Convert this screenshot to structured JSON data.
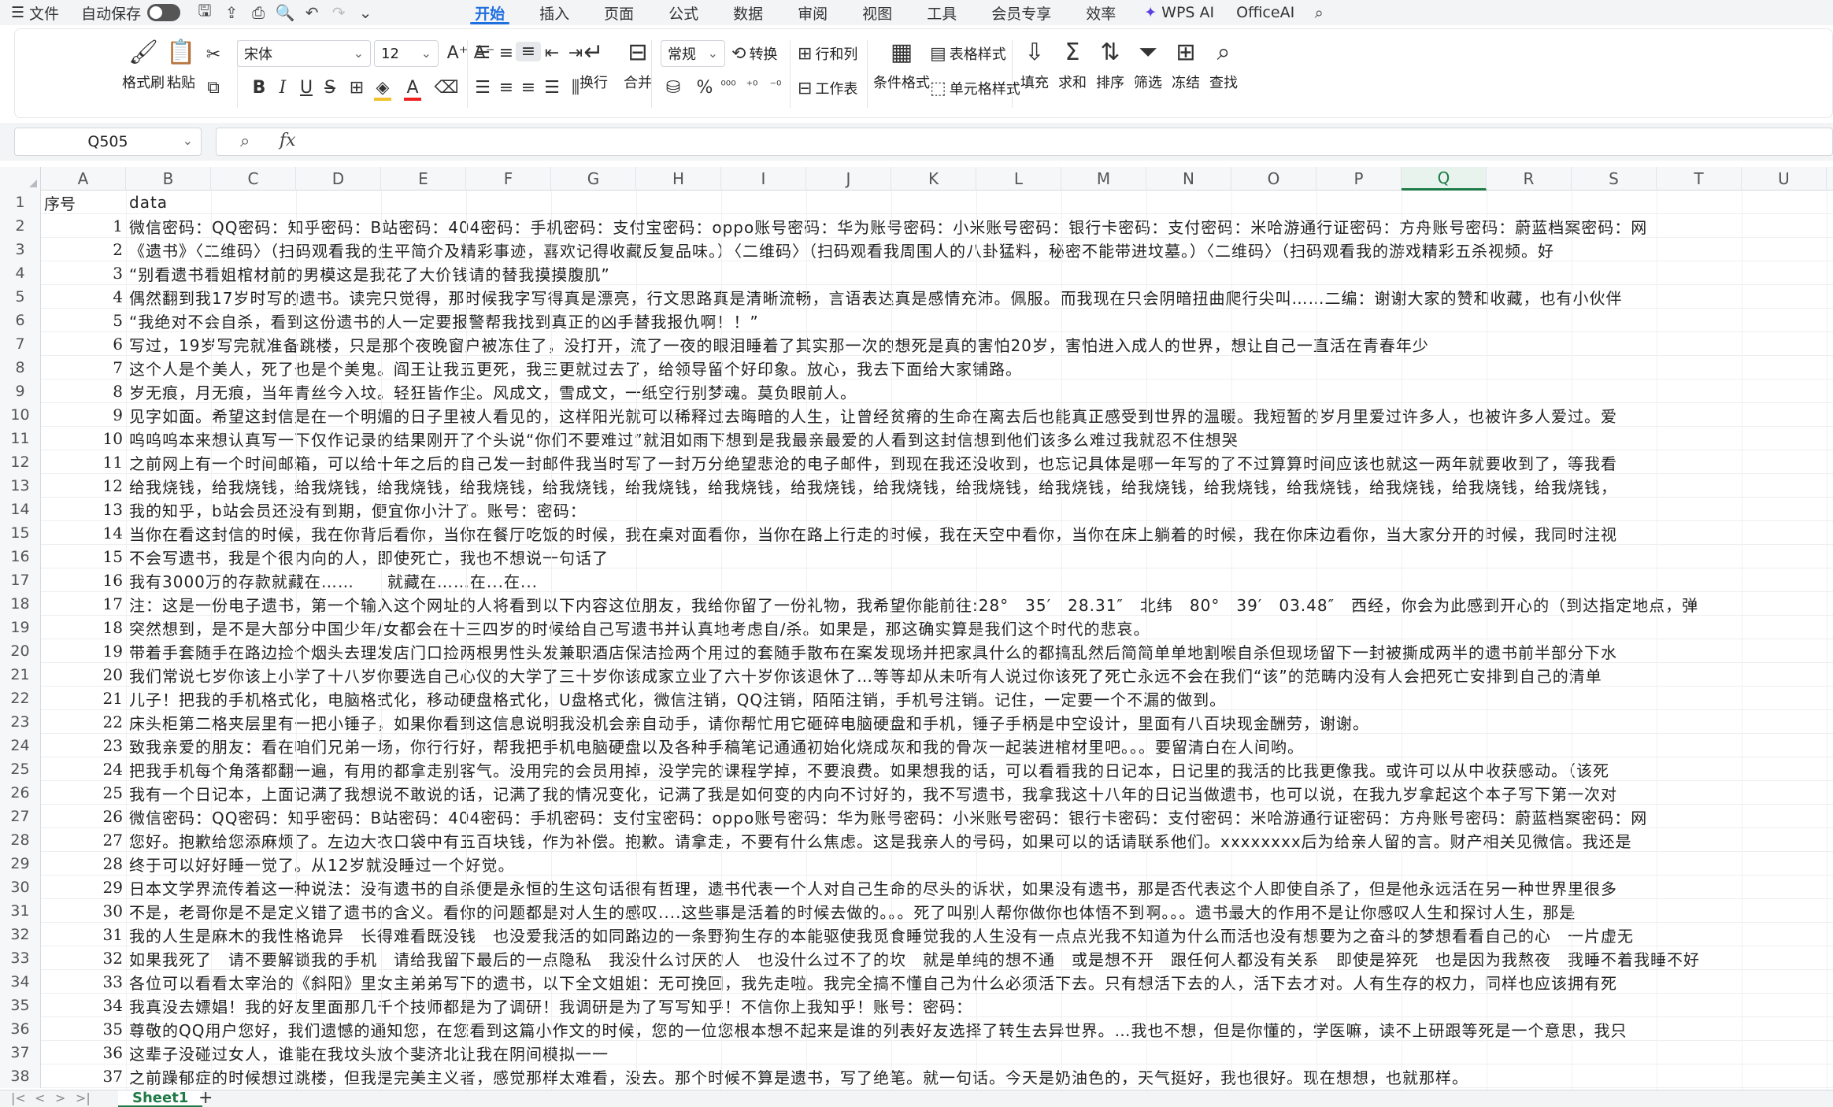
{
  "menu": {
    "file": "文件",
    "autosave": "自动保存",
    "tabs": [
      "开始",
      "插入",
      "页面",
      "公式",
      "数据",
      "审阅",
      "视图",
      "工具",
      "会员专享",
      "效率"
    ],
    "active_tab": "开始",
    "wps_ai": "WPS AI",
    "office_ai": "OfficeAI"
  },
  "ribbon": {
    "format_painter": "格式刷",
    "paste": "粘贴",
    "font_name": "宋体",
    "font_size": "12",
    "bold": "B",
    "italic": "I",
    "underline": "U",
    "strike": "S",
    "font_color_letter": "A",
    "wrap": "换行",
    "merge": "合并",
    "number_format": "常规",
    "convert": "转换",
    "percent": "%",
    "rows_cols": "行和列",
    "worksheet": "工作表",
    "cond_format": "条件格式",
    "table_style": "表格样式",
    "cell_style": "单元格样式",
    "fill": "填充",
    "sum": "求和",
    "sort": "排序",
    "filter": "筛选",
    "freeze": "冻结",
    "find": "查找"
  },
  "formula_bar": {
    "name_box": "Q505",
    "fx": "fx",
    "content": ""
  },
  "columns": [
    "A",
    "B",
    "C",
    "D",
    "E",
    "F",
    "G",
    "H",
    "I",
    "J",
    "K",
    "L",
    "M",
    "N",
    "O",
    "P",
    "Q",
    "R",
    "S",
    "T",
    "U"
  ],
  "selected_column": "Q",
  "header_row": {
    "a": "序号",
    "b": "data"
  },
  "rows": [
    {
      "n": "1",
      "a": "",
      "b": ""
    },
    {
      "n": "2",
      "a": "1",
      "b": "微信密码：QQ密码：知乎密码：B站密码：404密码：手机密码：支付宝密码：oppo账号密码：华为账号密码：小米账号密码：银行卡密码：支付密码：米哈游通行证密码：方舟账号密码：蔚蓝档案密码：网"
    },
    {
      "n": "3",
      "a": "2",
      "b": "《遗书》〈二维码〉（扫码观看我的生平简介及精彩事迹，喜欢记得收藏反复品味。）〈二维码〉（扫码观看我周围人的八卦猛料，秘密不能带进坟墓。）〈二维码〉（扫码观看我的游戏精彩五杀视频。好"
    },
    {
      "n": "4",
      "a": "3",
      "b": "“别看遗书看姐棺材前的男模这是我花了大价钱请的替我摸摸腹肌”"
    },
    {
      "n": "5",
      "a": "4",
      "b": "偶然翻到我17岁时写的遗书。读完只觉得，那时候我字写得真是漂亮，行文思路真是清晰流畅，言语表达真是感情充沛。佩服。而我现在只会阴暗扭曲爬行尖叫……二编：谢谢大家的赞和收藏，也有小伙伴"
    },
    {
      "n": "6",
      "a": "5",
      "b": "“我绝对不会自杀，看到这份遗书的人一定要报警帮我找到真正的凶手替我报仇啊！！”"
    },
    {
      "n": "7",
      "a": "6",
      "b": "写过，19岁写完就准备跳楼，只是那个夜晚窗户被冻住了，没打开，流了一夜的眼泪睡着了其实那一次的想死是真的害怕20岁，害怕进入成人的世界，想让自己一直活在青春年少"
    },
    {
      "n": "8",
      "a": "7",
      "b": "这个人是个美人，死了也是个美鬼。阎王让我五更死，我三更就过去了，给领导留个好印象。放心，我去下面给大家铺路。"
    },
    {
      "n": "9",
      "a": "8",
      "b": "岁无痕，月无痕，当年青丝今入坟。轻狂皆作尘。风成文，雪成文，一纸空行别梦魂。莫负眼前人。"
    },
    {
      "n": "10",
      "a": "9",
      "b": "见字如面。希望这封信是在一个明媚的日子里被人看见的，这样阳光就可以稀释过去晦暗的人生，让曾经贫瘠的生命在离去后也能真正感受到世界的温暖。我短暂的岁月里爱过许多人，也被许多人爱过。爱"
    },
    {
      "n": "11",
      "a": "10",
      "b": "呜呜呜本来想认真写一下仅作记录的结果刚开了个头说“你们不要难过”就泪如雨下想到是我最亲最爱的人看到这封信想到他们该多么难过我就忍不住想哭"
    },
    {
      "n": "12",
      "a": "11",
      "b": "之前网上有一个时间邮箱，可以给十年之后的自己发一封邮件我当时写了一封万分绝望悲沧的电子邮件，到现在我还没收到，也忘记具体是哪一年写的了不过算算时间应该也就这一两年就要收到了，等我看"
    },
    {
      "n": "13",
      "a": "12",
      "b": "给我烧钱，给我烧钱，给我烧钱，给我烧钱，给我烧钱，给我烧钱，给我烧钱，给我烧钱，给我烧钱，给我烧钱，给我烧钱，给我烧钱，给我烧钱，给我烧钱，给我烧钱，给我烧钱，给我烧钱，给我烧钱，"
    },
    {
      "n": "14",
      "a": "13",
      "b": "我的知乎，b站会员还没有到期，便宜你小汁了。账号：密码："
    },
    {
      "n": "15",
      "a": "14",
      "b": "当你在看这封信的时候，我在你背后看你，当你在餐厅吃饭的时候，我在桌对面看你，当你在路上行走的时候，我在天空中看你，当你在床上躺着的时候，我在你床边看你，当大家分开的时候，我同时注视"
    },
    {
      "n": "16",
      "a": "15",
      "b": "不会写遗书，我是个很内向的人，即使死亡，我也不想说一句话了"
    },
    {
      "n": "17",
      "a": "16",
      "b": "我有3000万的存款就藏在……　　就藏在……在...在..."
    },
    {
      "n": "18",
      "a": "17",
      "b": "注：这是一份电子遗书，第一个输入这个网址的人将看到以下内容这位朋友，我给你留了一份礼物，我希望你能前往:28°　35′　28.31″　北纬　80°　39′　03.48″　西经，你会为此感到开心的（到达指定地点，弹"
    },
    {
      "n": "19",
      "a": "18",
      "b": "突然想到，是不是大部分中国少年/女都会在十三四岁的时候给自己写遗书并认真地考虑自/杀。如果是，那这确实算是我们这个时代的悲哀。"
    },
    {
      "n": "20",
      "a": "19",
      "b": "带着手套随手在路边捡个烟头去理发店门口捡两根男性头发兼职酒店保洁捡两个用过的套随手散布在案发现场并把家具什么的都搞乱然后简简单单地割喉自杀但现场留下一封被撕成两半的遗书前半部分下水"
    },
    {
      "n": "21",
      "a": "20",
      "b": "我们常说七岁你该上小学了十八岁你要选自己心仪的大学了三十岁你该成家立业了六十岁你该退休了…等等却从未听有人说过你该死了死亡永远不会在我们“该”的范畴内没有人会把死亡安排到自己的清单"
    },
    {
      "n": "22",
      "a": "21",
      "b": "儿子！把我的手机格式化，电脑格式化，移动硬盘格式化，U盘格式化，微信注销，QQ注销，陌陌注销，手机号注销。记住，一定要一个不漏的做到。"
    },
    {
      "n": "23",
      "a": "22",
      "b": "床头柜第二格夹层里有一把小锤子，如果你看到这信息说明我没机会亲自动手，请你帮忙用它砸碎电脑硬盘和手机，锤子手柄是中空设计，里面有八百块现金酬劳，谢谢。"
    },
    {
      "n": "24",
      "a": "23",
      "b": "致我亲爱的朋友：看在咱们兄弟一场，你行行好，帮我把手机电脑硬盘以及各种手稿笔记通通初始化烧成灰和我的骨灰一起装进棺材里吧。。。要留清白在人间哟。"
    },
    {
      "n": "25",
      "a": "24",
      "b": "把我手机每个角落都翻一遍，有用的都拿走别客气。没用完的会员用掉，没学完的课程学掉，不要浪费。如果想我的话，可以看看我的日记本，日记里的我活的比我更像我。或许可以从中收获感动。（该死"
    },
    {
      "n": "26",
      "a": "25",
      "b": "我有一个日记本，上面记满了我想说不敢说的话，记满了我的情况变化，记满了我是如何变的内向不讨好的，我不写遗书，我拿我这十八年的日记当做遗书，也可以说，在我九岁拿起这个本子写下第一次对"
    },
    {
      "n": "27",
      "a": "26",
      "b": "微信密码：QQ密码：知乎密码：B站密码：404密码：手机密码：支付宝密码：oppo账号密码：华为账号密码：小米账号密码：银行卡密码：支付密码：米哈游通行证密码：方舟账号密码：蔚蓝档案密码：网"
    },
    {
      "n": "28",
      "a": "27",
      "b": "您好。抱歉给您添麻烦了。左边大衣口袋中有五百块钱，作为补偿。抱歉。请拿走，不要有什么焦虑。这是我亲人的号码，如果可以的话请联系他们。xxxxxxxx后为给亲人留的言。财产相关见微信。我还是"
    },
    {
      "n": "29",
      "a": "28",
      "b": "终于可以好好睡一觉了。从12岁就没睡过一个好觉。"
    },
    {
      "n": "30",
      "a": "29",
      "b": "日本文学界流传着这一种说法：没有遗书的自杀便是永恒的生这句话很有哲理，遗书代表一个人对自己生命的尽头的诉状，如果没有遗书，那是否代表这个人即使自杀了，但是他永远活在另一种世界里很多"
    },
    {
      "n": "31",
      "a": "30",
      "b": "不是，老哥你是不是定义错了遗书的含义。看你的问题都是对人生的感叹....这些事是活着的时候去做的。。。死了叫别人帮你做你也体悟不到啊。。。遗书最大的作用不是让你感叹人生和探讨人生，那是"
    },
    {
      "n": "32",
      "a": "31",
      "b": "我的人生是麻木的我性格诡异　长得难看既没钱　也没爱我活的如同路边的一条野狗生存的本能驱使我觅食睡觉我的人生没有一点点光我不知道为什么而活也没有想要为之奋斗的梦想看看自己的心　一片虚无"
    },
    {
      "n": "33",
      "a": "32",
      "b": "如果我死了　请不要解锁我的手机　请给我留下最后的一点隐私　我没什么讨厌的人　也没什么过不了的坎　就是单纯的想不通　或是想不开　跟任何人都没有关系　即使是猝死　也是因为我熬夜　我睡不着我睡不好"
    },
    {
      "n": "34",
      "a": "33",
      "b": "各位可以看看太宰治的《斜阳》里女主弟弟写下的遗书，以下全文姐姐：无可挽回，我先走啦。我完全搞不懂自己为什么必须活下去。只有想活下去的人，活下去才对。人有生存的权力，同样也应该拥有死"
    },
    {
      "n": "35",
      "a": "34",
      "b": "我真没去嫖娼！我的好友里面那几千个技师都是为了调研！我调研是为了写写知乎！不信你上我知乎！账号：密码："
    },
    {
      "n": "36",
      "a": "35",
      "b": "尊敬的QQ用户您好，我们遗憾的通知您，在您看到这篇小作文的时候，您的一位您根本想不起来是谁的列表好友选择了转生去异世界。…我也不想，但是你懂的，学医嘛，读不上研跟等死是一个意思，我只"
    },
    {
      "n": "37",
      "a": "36",
      "b": "这辈子没碰过女人，谁能在我坟头放个斐济北让我在阴间模拟一一"
    },
    {
      "n": "38",
      "a": "37",
      "b": "之前躁郁症的时候想过跳楼，但我是完美主义者，感觉那样太难看，没去。那个时候不算是遗书，写了绝笔。就一句话。今天是奶油色的，天气挺好，我也很好。现在想想，也就那样。"
    }
  ],
  "sheet": {
    "tab": "Sheet1",
    "add": "+"
  }
}
